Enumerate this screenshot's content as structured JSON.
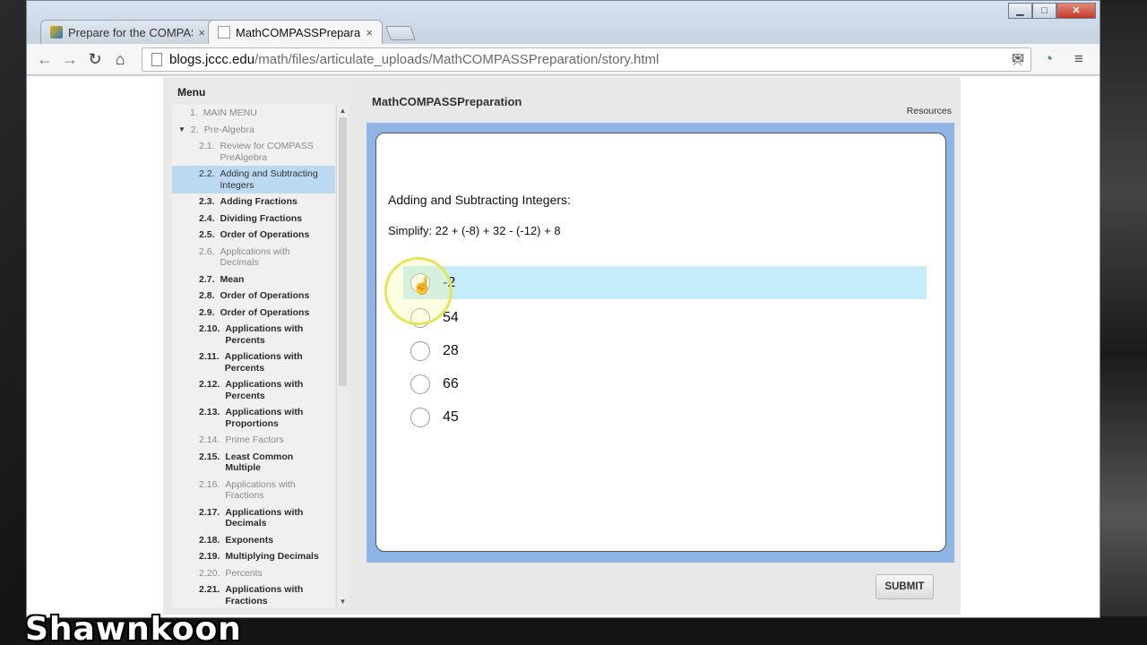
{
  "browser": {
    "tabs": [
      {
        "title": "Prepare for the COMPASS",
        "close": "×"
      },
      {
        "title": "MathCOMPASSPreparatio",
        "close": "×"
      }
    ],
    "url_host": "blogs.jccc.edu",
    "url_path": "/math/files/articulate_uploads/MathCOMPASSPreparation/story.html",
    "window_controls": {
      "minimize": "▁",
      "maximize": "□",
      "close": "✕"
    }
  },
  "player": {
    "menu_title": "Menu",
    "slide_title": "MathCOMPASSPreparation",
    "resources_label": "Resources",
    "menu_items": [
      {
        "num": "1.",
        "label": "MAIN MENU",
        "state": "visited",
        "level": 1
      },
      {
        "num": "2.",
        "label": "Pre-Algebra",
        "state": "visited",
        "level": 1,
        "expanded": true
      },
      {
        "num": "2.1.",
        "label": "Review for COMPASS PreAlgebra",
        "state": "visited",
        "level": 2
      },
      {
        "num": "2.2.",
        "label": "Adding and Subtracting Integers",
        "state": "selected",
        "level": 2
      },
      {
        "num": "2.3.",
        "label": "Adding Fractions",
        "state": "unvisited",
        "level": 2
      },
      {
        "num": "2.4.",
        "label": "Dividing Fractions",
        "state": "unvisited",
        "level": 2
      },
      {
        "num": "2.5.",
        "label": "Order of Operations",
        "state": "unvisited",
        "level": 2
      },
      {
        "num": "2.6.",
        "label": "Applications with Decimals",
        "state": "visited",
        "level": 2
      },
      {
        "num": "2.7.",
        "label": "Mean",
        "state": "unvisited",
        "level": 2
      },
      {
        "num": "2.8.",
        "label": "Order of Operations",
        "state": "unvisited",
        "level": 2
      },
      {
        "num": "2.9.",
        "label": "Order of Operations",
        "state": "unvisited",
        "level": 2
      },
      {
        "num": "2.10.",
        "label": "Applications with Percents",
        "state": "unvisited",
        "level": 2
      },
      {
        "num": "2.11.",
        "label": "Applications with Percents",
        "state": "unvisited",
        "level": 2
      },
      {
        "num": "2.12.",
        "label": "Applications with Percents",
        "state": "unvisited",
        "level": 2
      },
      {
        "num": "2.13.",
        "label": "Applications with Proportions",
        "state": "unvisited",
        "level": 2
      },
      {
        "num": "2.14.",
        "label": "Prime Factors",
        "state": "visited",
        "level": 2
      },
      {
        "num": "2.15.",
        "label": "Least Common Multiple",
        "state": "unvisited",
        "level": 2
      },
      {
        "num": "2.16.",
        "label": "Applications with Fractions",
        "state": "visited",
        "level": 2
      },
      {
        "num": "2.17.",
        "label": "Applications with Decimals",
        "state": "unvisited",
        "level": 2
      },
      {
        "num": "2.18.",
        "label": "Exponents",
        "state": "unvisited",
        "level": 2
      },
      {
        "num": "2.19.",
        "label": "Multiplying Decimals",
        "state": "unvisited",
        "level": 2
      },
      {
        "num": "2.20.",
        "label": "Percents",
        "state": "visited",
        "level": 2
      },
      {
        "num": "2.21.",
        "label": "Applications with Fractions",
        "state": "unvisited",
        "level": 2
      }
    ],
    "question": {
      "title": "Adding and Subtracting Integers:",
      "prompt": "Simplify: 22 + (-8) + 32 - (-12) + 8",
      "choices": [
        "-2",
        "54",
        "28",
        "66",
        "45"
      ],
      "hovered_choice": "-2"
    },
    "submit_label": "SUBMIT"
  },
  "watermark": "Shawnkoon"
}
